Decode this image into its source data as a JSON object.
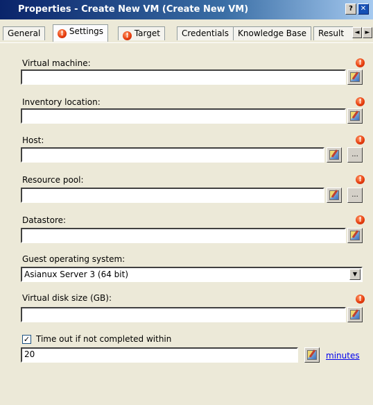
{
  "window": {
    "title": "Properties - Create New VM (Create New VM)",
    "help_button": "?",
    "close_button": "✕"
  },
  "tabs": [
    {
      "label": "General"
    },
    {
      "label": "Settings",
      "warning": "!"
    },
    {
      "label": "Target",
      "warning": "!"
    },
    {
      "label": "Credentials"
    },
    {
      "label": "Knowledge Base"
    },
    {
      "label": "Result"
    }
  ],
  "tab_scroll": {
    "left": "◄",
    "right": "►"
  },
  "fields": {
    "virtual_machine": {
      "label": "Virtual machine:",
      "value": ""
    },
    "inventory_location": {
      "label": "Inventory location:",
      "value": ""
    },
    "host": {
      "label": "Host:",
      "value": "",
      "browse": "..."
    },
    "resource_pool": {
      "label": "Resource pool:",
      "value": "",
      "browse": "..."
    },
    "datastore": {
      "label": "Datastore:",
      "value": ""
    },
    "guest_os": {
      "label": "Guest operating system:",
      "value": "Asianux Server 3 (64 bit)"
    },
    "disk_size": {
      "label": "Virtual disk size (GB):",
      "value": ""
    }
  },
  "timeout": {
    "checked": "✓",
    "label": "Time out if not completed within",
    "value": "20",
    "unit_link": "minutes"
  },
  "warning_glyph": "!",
  "accent": {
    "titlebar": "#0a246a",
    "warning": "#e84010",
    "link": "#0000ee"
  }
}
